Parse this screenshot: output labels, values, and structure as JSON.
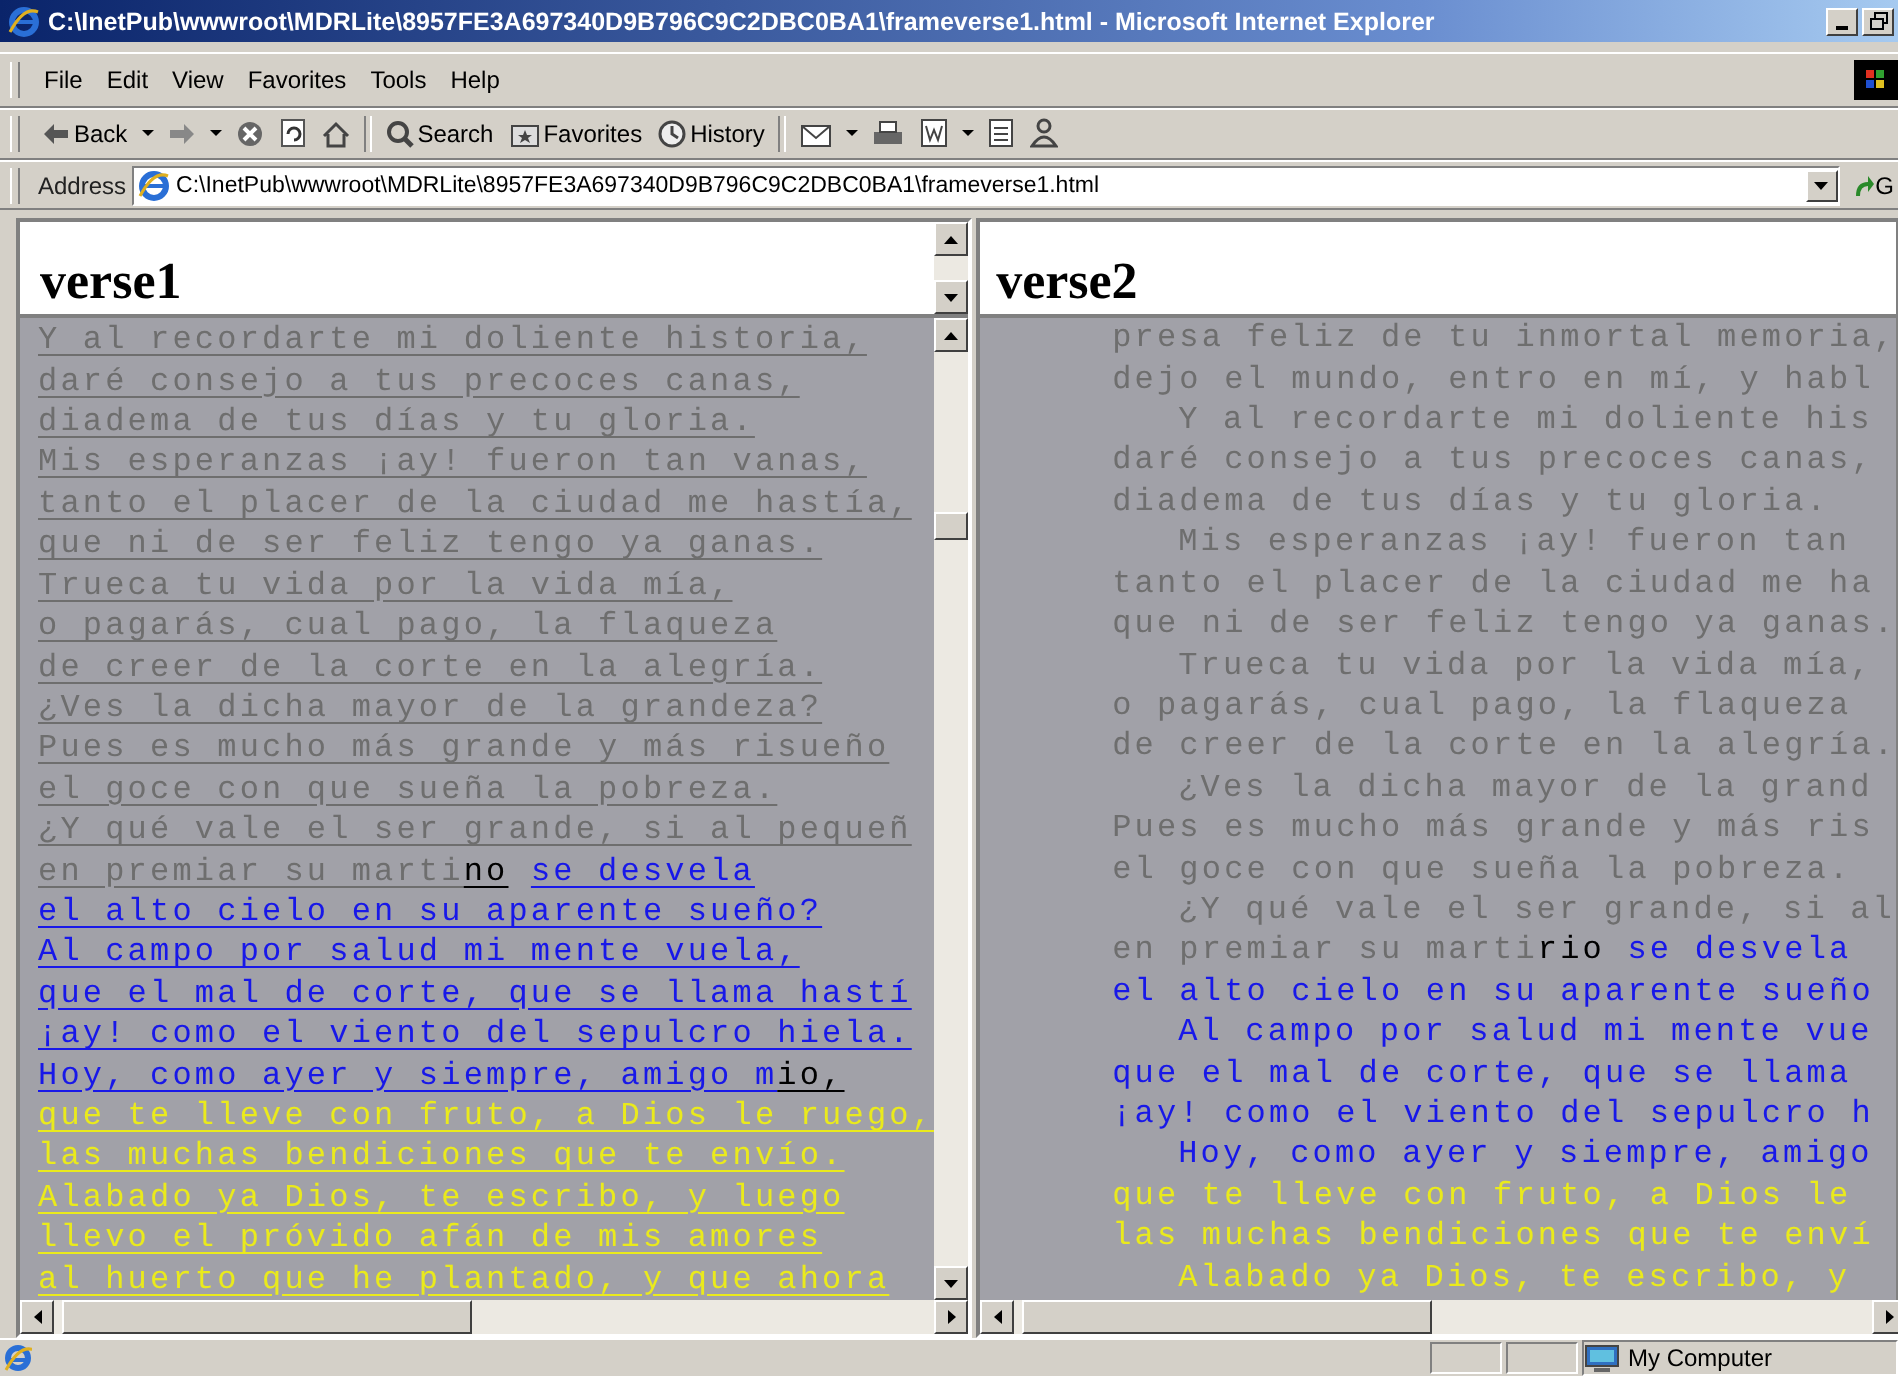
{
  "window": {
    "title": "C:\\InetPub\\wwwroot\\MDRLite\\8957FE3A697340D9B796C9C2DBC0BA1\\frameverse1.html - Microsoft Internet Explorer"
  },
  "menu": [
    "File",
    "Edit",
    "View",
    "Favorites",
    "Tools",
    "Help"
  ],
  "toolbar": [
    {
      "kind": "back",
      "label": "Back"
    },
    {
      "kind": "forward"
    },
    {
      "kind": "stop"
    },
    {
      "kind": "refresh"
    },
    {
      "kind": "home"
    },
    {
      "kind": "search",
      "label": "Search"
    },
    {
      "kind": "favorites",
      "label": "Favorites"
    },
    {
      "kind": "history",
      "label": "History"
    },
    {
      "kind": "mail"
    },
    {
      "kind": "print"
    },
    {
      "kind": "edit"
    },
    {
      "kind": "discuss"
    },
    {
      "kind": "messenger"
    }
  ],
  "address": {
    "label": "Address",
    "value": "C:\\InetPub\\wwwroot\\MDRLite\\8957FE3A697340D9B796C9C2DBC0BA1\\frameverse1.html",
    "go": "G"
  },
  "frames": [
    {
      "heading": "verse1",
      "underlined": true,
      "lines": [
        {
          "segments": [
            {
              "text": "Y al recordarte mi doliente historia,",
              "color": "#6e6e6e"
            }
          ]
        },
        {
          "segments": [
            {
              "text": "daré consejo a tus precoces canas,",
              "color": "#6e6e6e"
            }
          ]
        },
        {
          "segments": [
            {
              "text": "diadema de tus días y tu gloria.",
              "color": "#6e6e6e"
            }
          ]
        },
        {
          "segments": [
            {
              "text": "Mis esperanzas ¡ay! fueron tan vanas,",
              "color": "#6e6e6e"
            }
          ]
        },
        {
          "segments": [
            {
              "text": "tanto el placer de la ciudad me hastía,",
              "color": "#6e6e6e"
            }
          ]
        },
        {
          "segments": [
            {
              "text": "que ni de ser feliz tengo ya ganas.",
              "color": "#6e6e6e"
            }
          ]
        },
        {
          "segments": [
            {
              "text": "Trueca tu vida por la vida mía,",
              "color": "#6e6e6e"
            }
          ]
        },
        {
          "segments": [
            {
              "text": "o pagarás, cual pago, la flaqueza",
              "color": "#6e6e6e"
            }
          ]
        },
        {
          "segments": [
            {
              "text": "de creer de la corte en la alegría.",
              "color": "#6e6e6e"
            }
          ]
        },
        {
          "segments": [
            {
              "text": "¿Ves la dicha mayor de la grandeza?",
              "color": "#6e6e6e"
            }
          ]
        },
        {
          "segments": [
            {
              "text": "Pues es mucho más grande y más risueño",
              "color": "#6e6e6e"
            }
          ]
        },
        {
          "segments": [
            {
              "text": "el goce con que sueña la pobreza.",
              "color": "#6e6e6e"
            }
          ]
        },
        {
          "segments": [
            {
              "text": "¿Y qué vale el ser grande, si al pequeñ",
              "color": "#6e6e6e"
            }
          ]
        },
        {
          "segments": [
            {
              "text": "en premiar su marti",
              "color": "#6e6e6e"
            },
            {
              "text": "no",
              "color": "#000000"
            },
            {
              "text": "se desvela",
              "color": "#1818e8"
            }
          ]
        },
        {
          "segments": [
            {
              "text": "el alto cielo en su aparente sueño?",
              "color": "#1818e8"
            }
          ]
        },
        {
          "segments": [
            {
              "text": "Al campo por salud mi mente vuela,",
              "color": "#1818e8"
            }
          ]
        },
        {
          "segments": [
            {
              "text": "que el mal de corte, que se llama hastí",
              "color": "#1818e8"
            }
          ]
        },
        {
          "segments": [
            {
              "text": "¡ay! como el viento del sepulcro hiela.",
              "color": "#1818e8"
            }
          ]
        },
        {
          "segments": [
            {
              "text": "Hoy, como ayer y siempre, amigo m",
              "color": "#1818e8"
            },
            {
              "text": "io,",
              "color": "#000000"
            }
          ]
        },
        {
          "segments": [
            {
              "text": "que te lleve con fruto, a Dios le ruego,",
              "color": "#eaea1c"
            }
          ]
        },
        {
          "segments": [
            {
              "text": "las muchas bendiciones que te envío.",
              "color": "#eaea1c"
            }
          ]
        },
        {
          "segments": [
            {
              "text": "Alabado ya Dios, te escribo, y luego",
              "color": "#eaea1c"
            }
          ]
        },
        {
          "segments": [
            {
              "text": "llevo el próvido afán de mis amores",
              "color": "#eaea1c"
            }
          ]
        },
        {
          "segments": [
            {
              "text": "al huerto que he plantado, y que ahora",
              "color": "#eaea1c"
            }
          ]
        }
      ]
    },
    {
      "heading": "verse2",
      "underlined": false,
      "lines": [
        {
          "indent": false,
          "segments": [
            {
              "text": "presa feliz de tu inmortal memoria,",
              "color": "#6e6e6e"
            }
          ]
        },
        {
          "indent": false,
          "segments": [
            {
              "text": "dejo el mundo, entro en mí, y habl",
              "color": "#6e6e6e"
            }
          ]
        },
        {
          "indent": true,
          "segments": [
            {
              "text": "Y al recordarte mi doliente his",
              "color": "#6e6e6e"
            }
          ]
        },
        {
          "indent": false,
          "segments": [
            {
              "text": "daré consejo a tus precoces canas,",
              "color": "#6e6e6e"
            }
          ]
        },
        {
          "indent": false,
          "segments": [
            {
              "text": "diadema de tus días y tu gloria.",
              "color": "#6e6e6e"
            }
          ]
        },
        {
          "indent": true,
          "segments": [
            {
              "text": "Mis esperanzas ¡ay! fueron tan",
              "color": "#6e6e6e"
            }
          ]
        },
        {
          "indent": false,
          "segments": [
            {
              "text": "tanto el placer de la ciudad me ha",
              "color": "#6e6e6e"
            }
          ]
        },
        {
          "indent": false,
          "segments": [
            {
              "text": "que ni de ser feliz tengo ya ganas.",
              "color": "#6e6e6e"
            }
          ]
        },
        {
          "indent": true,
          "segments": [
            {
              "text": "Trueca tu vida por la vida mía,",
              "color": "#6e6e6e"
            }
          ]
        },
        {
          "indent": false,
          "segments": [
            {
              "text": "o pagarás, cual pago, la flaqueza",
              "color": "#6e6e6e"
            }
          ]
        },
        {
          "indent": false,
          "segments": [
            {
              "text": "de creer de la corte en la alegría.",
              "color": "#6e6e6e"
            }
          ]
        },
        {
          "indent": true,
          "segments": [
            {
              "text": "¿Ves la dicha mayor de la grand",
              "color": "#6e6e6e"
            }
          ]
        },
        {
          "indent": false,
          "segments": [
            {
              "text": "Pues es mucho más grande y más ris",
              "color": "#6e6e6e"
            }
          ]
        },
        {
          "indent": false,
          "segments": [
            {
              "text": "el goce con que sueña la pobreza.",
              "color": "#6e6e6e"
            }
          ]
        },
        {
          "indent": true,
          "segments": [
            {
              "text": "¿Y qué vale el ser grande, si al",
              "color": "#6e6e6e"
            }
          ]
        },
        {
          "indent": false,
          "segments": [
            {
              "text": "en premiar su marti",
              "color": "#6e6e6e"
            },
            {
              "text": "rio",
              "color": "#000000"
            },
            {
              "text": "se desvela",
              "color": "#1818e8"
            }
          ]
        },
        {
          "indent": false,
          "segments": [
            {
              "text": "el alto cielo en su aparente sueño",
              "color": "#1818e8"
            }
          ]
        },
        {
          "indent": true,
          "segments": [
            {
              "text": "Al campo por salud mi mente vue",
              "color": "#1818e8"
            }
          ]
        },
        {
          "indent": false,
          "segments": [
            {
              "text": "que el mal de corte, que se llama",
              "color": "#1818e8"
            }
          ]
        },
        {
          "indent": false,
          "segments": [
            {
              "text": "¡ay! como el viento del sepulcro h",
              "color": "#1818e8"
            }
          ]
        },
        {
          "indent": true,
          "segments": [
            {
              "text": "Hoy, como ayer y siempre, amigo",
              "color": "#1818e8"
            }
          ]
        },
        {
          "indent": false,
          "segments": [
            {
              "text": "que te lleve con fruto, a Dios le",
              "color": "#eaea1c"
            }
          ]
        },
        {
          "indent": false,
          "segments": [
            {
              "text": "las muchas bendiciones que te enví",
              "color": "#eaea1c"
            }
          ]
        },
        {
          "indent": true,
          "segments": [
            {
              "text": "Alabado ya Dios, te escribo, y",
              "color": "#eaea1c"
            }
          ]
        }
      ]
    }
  ],
  "status_bar": {
    "zone": "My Computer"
  }
}
